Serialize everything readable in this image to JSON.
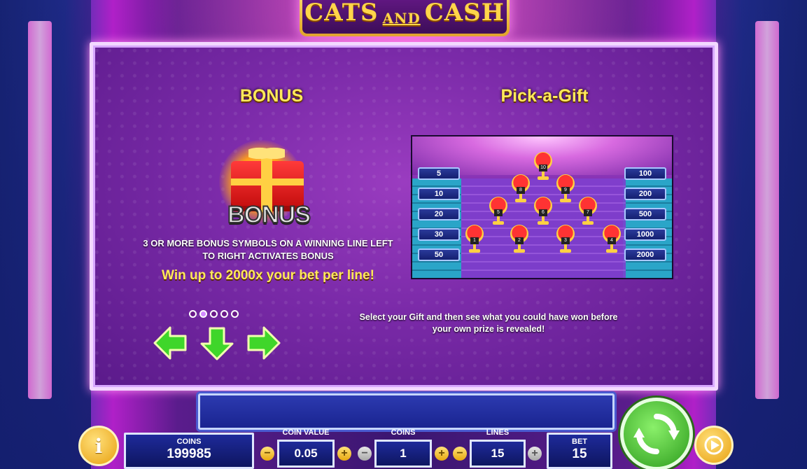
{
  "game": {
    "logo_word1": "CATS",
    "logo_and": "AND",
    "logo_word2": "CASH"
  },
  "paytable": {
    "left_title": "BONUS",
    "right_title": "Pick-a-Gift",
    "bonus_symbol_text": "BONUS",
    "rule_line1": "3 OR MORE BONUS SYMBOLS ON A WINNING LINE LEFT",
    "rule_line2": "TO RIGHT ACTIVATES BONUS",
    "win_text": "Win up to 2000x your bet per line!",
    "pick_desc_line1": "Select your Gift and then see what you could have won before",
    "pick_desc_line2": "your own prize is revealed!",
    "page_count": 5,
    "active_page": 2,
    "left_prizes": [
      "5",
      "10",
      "20",
      "30",
      "50"
    ],
    "right_prizes": [
      "100",
      "200",
      "500",
      "1000",
      "2000"
    ],
    "trophy_numbers": [
      "10",
      "8",
      "9",
      "5",
      "6",
      "7",
      "1",
      "2",
      "3",
      "4"
    ]
  },
  "controls": {
    "coins_label": "COINS",
    "coins_value": "199985",
    "coin_value_label": "COIN VALUE",
    "coin_value": "0.05",
    "coins_step_label": "COINS",
    "coins_step_value": "1",
    "lines_label": "LINES",
    "lines_value": "15",
    "bet_label": "BET",
    "bet_value": "15",
    "info_glyph": "i",
    "minus_glyph": "−",
    "plus_glyph": "+"
  },
  "colors": {
    "accent_yellow": "#ffe95a",
    "panel_purple": "#7a2aa8",
    "spin_green": "#2c9c1c"
  }
}
